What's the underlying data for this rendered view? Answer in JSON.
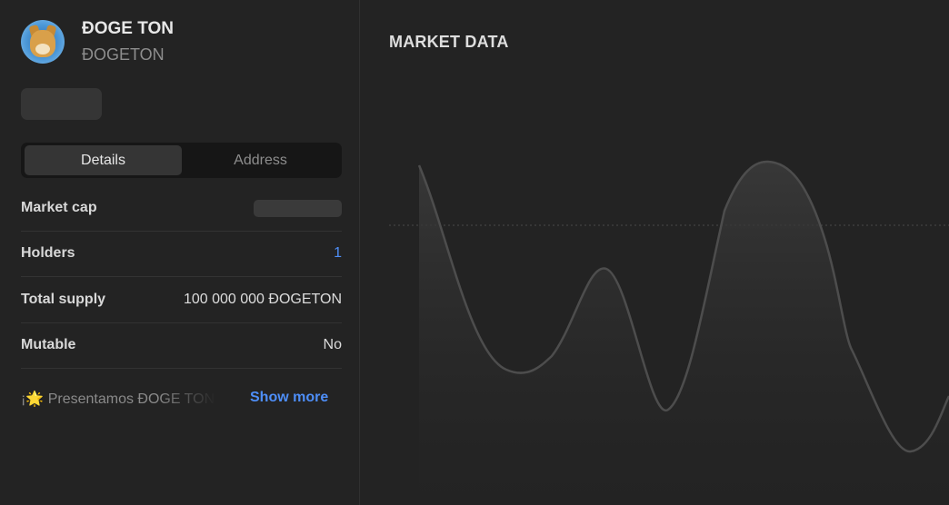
{
  "token": {
    "name": "ĐOGE TON",
    "symbol": "ĐOGETON"
  },
  "tabs": [
    {
      "label": "Details",
      "active": true
    },
    {
      "label": "Address",
      "active": false
    }
  ],
  "details": [
    {
      "key": "Market cap",
      "value": null,
      "loading": true
    },
    {
      "key": "Holders",
      "value": "1",
      "link": true
    },
    {
      "key": "Total supply",
      "value": "100 000 000 ĐOGETON"
    },
    {
      "key": "Mutable",
      "value": "No"
    }
  ],
  "description": {
    "text": "¡🌟 Presentamos ĐOGE TON",
    "show_more_label": "Show more"
  },
  "market": {
    "title": "MARKET DATA"
  },
  "colors": {
    "accent": "#4e8ef7",
    "panel": "#232323",
    "divider": "#303030"
  }
}
